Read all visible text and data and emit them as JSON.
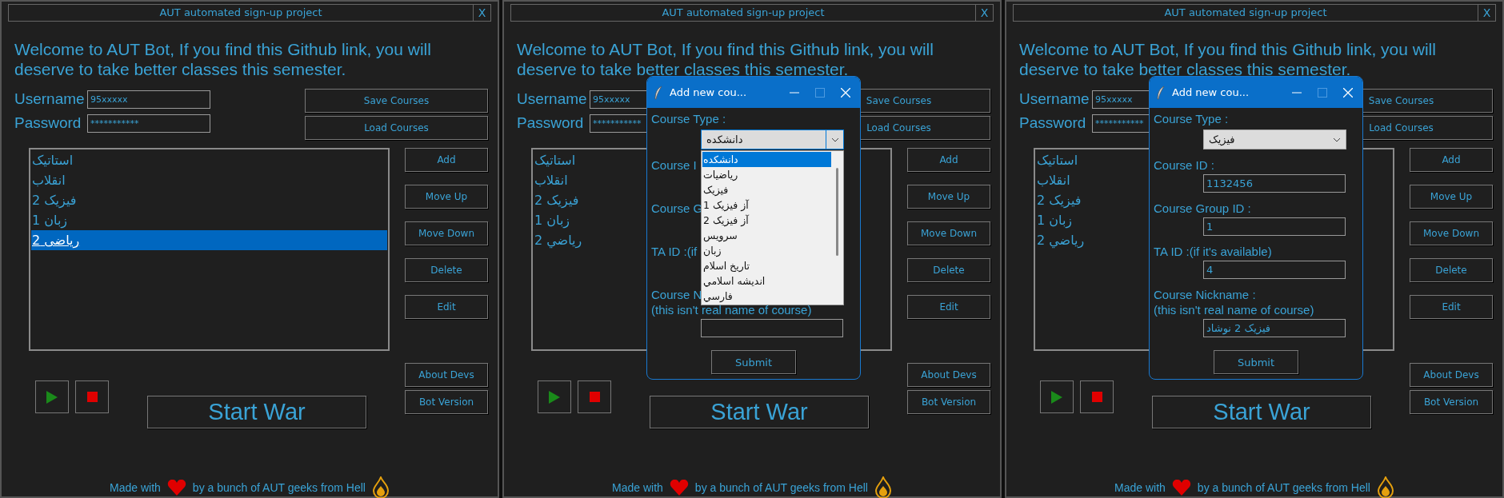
{
  "screens": [
    {
      "window": {
        "title": "AUT automated sign-up project",
        "close": "X",
        "welcome": "Welcome to AUT Bot, If you find this Github link, you will deserve to take better classes this semester.",
        "username_label": "Username",
        "username": "95xxxxx",
        "password_label": "Password",
        "password": "***********",
        "save_button": "Save Courses",
        "load_button": "Load Courses",
        "side_buttons": [
          "Add",
          "Move Up",
          "Move Down",
          "Delete",
          "Edit"
        ],
        "info_buttons": [
          "About Devs",
          "Bot Version"
        ],
        "start_button": "Start War",
        "footer_before": "Made with",
        "footer_after": "by a bunch of AUT geeks from Hell"
      },
      "course_list": [
        {
          "label": "استاتیک",
          "selected": false
        },
        {
          "label": "انقلاب",
          "selected": false
        },
        {
          "label": "فیزیک 2",
          "selected": false
        },
        {
          "label": "زبان 1",
          "selected": false
        },
        {
          "label": "ریاضی 2",
          "selected": true
        }
      ]
    },
    {
      "window": {
        "title": "AUT automated sign-up project",
        "close": "X",
        "welcome": "Welcome to AUT Bot, If you find this Github link, you will deserve to take better classes this semester.",
        "username_label": "Username",
        "username": "95xxxxx",
        "password_label": "Password",
        "password": "***********",
        "save_button": "Save Courses",
        "load_button": "Load Courses",
        "side_buttons": [
          "Add",
          "Move Up",
          "Move Down",
          "Delete",
          "Edit"
        ],
        "info_buttons": [
          "About Devs",
          "Bot Version"
        ],
        "start_button": "Start War",
        "footer_before": "Made with",
        "footer_after": "by a bunch of AUT geeks from Hell"
      },
      "course_list": [
        {
          "label": "استاتیک",
          "selected": false
        },
        {
          "label": "انقلاب",
          "selected": false
        },
        {
          "label": "فیزیک 2",
          "selected": false
        },
        {
          "label": "زبان 1",
          "selected": false
        },
        {
          "label": "رياضي 2",
          "selected": false
        }
      ],
      "dialog": {
        "title": "Add new cou...",
        "course_type_label": "Course Type :",
        "course_type": "دانشکده",
        "dropdown_open": true,
        "options": [
          {
            "label": "دانشکده",
            "selected": true
          },
          {
            "label": "ریاضیات",
            "selected": false
          },
          {
            "label": "فیزیک",
            "selected": false
          },
          {
            "label": "آز فیزیک 1",
            "selected": false
          },
          {
            "label": "آز فیزیک 2",
            "selected": false
          },
          {
            "label": "سرویس",
            "selected": false
          },
          {
            "label": "زبان",
            "selected": false
          },
          {
            "label": "تاریخ اسلام",
            "selected": false
          },
          {
            "label": "اندیشه اسلامي",
            "selected": false
          },
          {
            "label": "فارسي",
            "selected": false
          }
        ],
        "fields": [
          {
            "label": "Course I",
            "show_input": false
          },
          {
            "label": "Course G",
            "show_input": false
          },
          {
            "label": "TA ID :(if",
            "show_input": false
          },
          {
            "label": "Course N",
            "sublabel": "(this isn't real name of course)",
            "show_input": true
          }
        ],
        "submit": "Submit"
      }
    },
    {
      "window": {
        "title": "AUT automated sign-up project",
        "close": "X",
        "welcome": "Welcome to AUT Bot, If you find this Github link, you will deserve to take better classes this semester.",
        "username_label": "Username",
        "username": "95xxxxx",
        "password_label": "Password",
        "password": "***********",
        "save_button": "Save Courses",
        "load_button": "Load Courses",
        "side_buttons": [
          "Add",
          "Move Up",
          "Move Down",
          "Delete",
          "Edit"
        ],
        "info_buttons": [
          "About Devs",
          "Bot Version"
        ],
        "start_button": "Start War",
        "footer_before": "Made with",
        "footer_after": "by a bunch of AUT geeks from Hell"
      },
      "course_list": [
        {
          "label": "استاتیک",
          "selected": false
        },
        {
          "label": "انقلاب",
          "selected": false
        },
        {
          "label": "فیزیک 2",
          "selected": false
        },
        {
          "label": "زبان 1",
          "selected": false
        },
        {
          "label": "رياضي 2",
          "selected": false
        }
      ],
      "dialog": {
        "title": "Add new cou...",
        "course_type_label": "Course Type :",
        "course_type": "فیزیک",
        "dropdown_open": false,
        "fields": [
          {
            "label": "Course ID :",
            "show_input": true,
            "value": "1132456"
          },
          {
            "label": "Course Group ID :",
            "show_input": true,
            "value": "1"
          },
          {
            "label": "TA ID :(if it's available)",
            "show_input": true,
            "value": "4"
          },
          {
            "label": "Course Nickname :",
            "sublabel": "(this isn't real name of course)",
            "show_input": true,
            "value": "فیزیک 2 نوشاد"
          }
        ],
        "submit": "Submit"
      }
    }
  ]
}
